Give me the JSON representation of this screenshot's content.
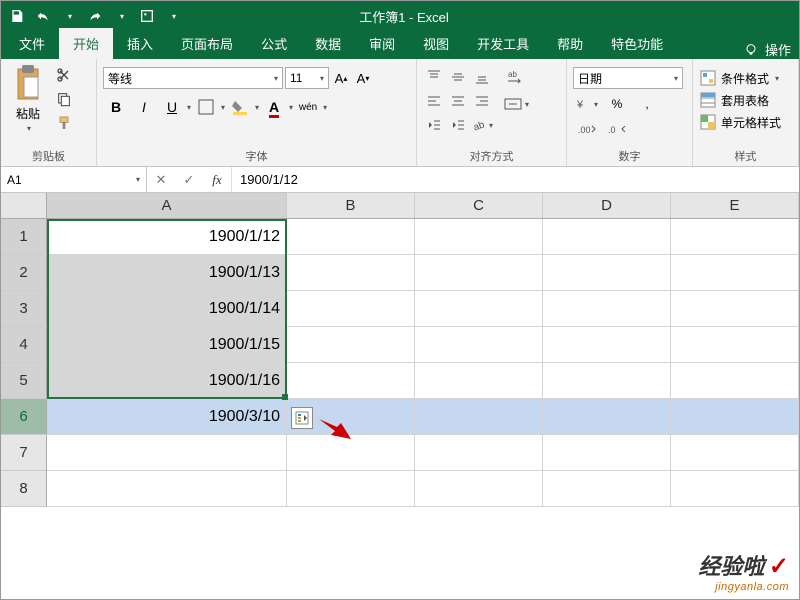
{
  "titlebar": {
    "title": "工作簿1 - Excel"
  },
  "tabs": {
    "file": "文件",
    "home": "开始",
    "insert": "插入",
    "layout": "页面布局",
    "formulas": "公式",
    "data": "数据",
    "review": "审阅",
    "view": "视图",
    "dev": "开发工具",
    "help": "帮助",
    "special": "特色功能",
    "tell": "操作"
  },
  "ribbon": {
    "clipboard": {
      "paste": "粘贴",
      "group": "剪贴板"
    },
    "font": {
      "name": "等线",
      "size": "11",
      "group": "字体",
      "wen": "wén"
    },
    "align": {
      "group": "对齐方式"
    },
    "number": {
      "format": "日期",
      "group": "数字",
      "percent": "%",
      "comma": ",",
      "decinc": ".0",
      "decdec": ".00"
    },
    "styles": {
      "cond": "条件格式",
      "table": "套用表格",
      "cell": "单元格样式",
      "group": "样式"
    }
  },
  "fbar": {
    "name": "A1",
    "value": "1900/1/12"
  },
  "cols": [
    "A",
    "B",
    "C",
    "D",
    "E"
  ],
  "rows": [
    "1",
    "2",
    "3",
    "4",
    "5",
    "6",
    "7",
    "8"
  ],
  "cells": {
    "A1": "1900/1/12",
    "A2": "1900/1/13",
    "A3": "1900/1/14",
    "A4": "1900/1/15",
    "A5": "1900/1/16",
    "A6": "1900/3/10"
  },
  "watermark": {
    "main": "经验啦",
    "check": "✓",
    "sub": "jingyanla.com"
  }
}
